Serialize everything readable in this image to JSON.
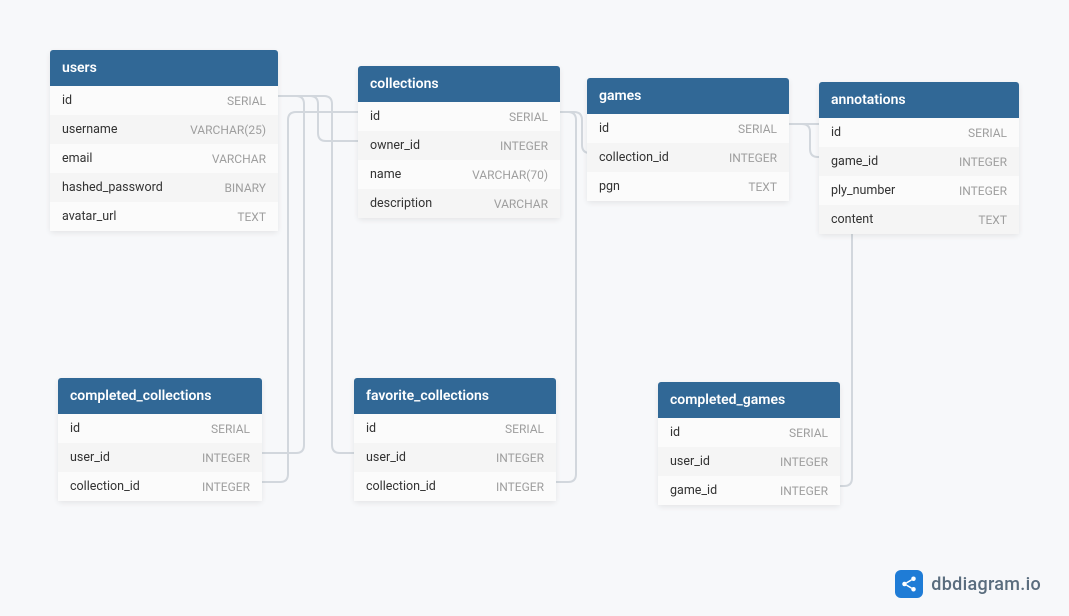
{
  "watermark": "dbdiagram.io",
  "tables": {
    "users": {
      "title": "users",
      "fields": [
        {
          "name": "id",
          "type": "SERIAL"
        },
        {
          "name": "username",
          "type": "VARCHAR(25)"
        },
        {
          "name": "email",
          "type": "VARCHAR"
        },
        {
          "name": "hashed_password",
          "type": "BINARY"
        },
        {
          "name": "avatar_url",
          "type": "TEXT"
        }
      ]
    },
    "collections": {
      "title": "collections",
      "fields": [
        {
          "name": "id",
          "type": "SERIAL"
        },
        {
          "name": "owner_id",
          "type": "INTEGER"
        },
        {
          "name": "name",
          "type": "VARCHAR(70)"
        },
        {
          "name": "description",
          "type": "VARCHAR"
        }
      ]
    },
    "games": {
      "title": "games",
      "fields": [
        {
          "name": "id",
          "type": "SERIAL"
        },
        {
          "name": "collection_id",
          "type": "INTEGER"
        },
        {
          "name": "pgn",
          "type": "TEXT"
        }
      ]
    },
    "annotations": {
      "title": "annotations",
      "fields": [
        {
          "name": "id",
          "type": "SERIAL"
        },
        {
          "name": "game_id",
          "type": "INTEGER"
        },
        {
          "name": "ply_number",
          "type": "INTEGER"
        },
        {
          "name": "content",
          "type": "TEXT"
        }
      ]
    },
    "completed_collections": {
      "title": "completed_collections",
      "fields": [
        {
          "name": "id",
          "type": "SERIAL"
        },
        {
          "name": "user_id",
          "type": "INTEGER"
        },
        {
          "name": "collection_id",
          "type": "INTEGER"
        }
      ]
    },
    "favorite_collections": {
      "title": "favorite_collections",
      "fields": [
        {
          "name": "id",
          "type": "SERIAL"
        },
        {
          "name": "user_id",
          "type": "INTEGER"
        },
        {
          "name": "collection_id",
          "type": "INTEGER"
        }
      ]
    },
    "completed_games": {
      "title": "completed_games",
      "fields": [
        {
          "name": "id",
          "type": "SERIAL"
        },
        {
          "name": "user_id",
          "type": "INTEGER"
        },
        {
          "name": "game_id",
          "type": "INTEGER"
        }
      ]
    }
  }
}
